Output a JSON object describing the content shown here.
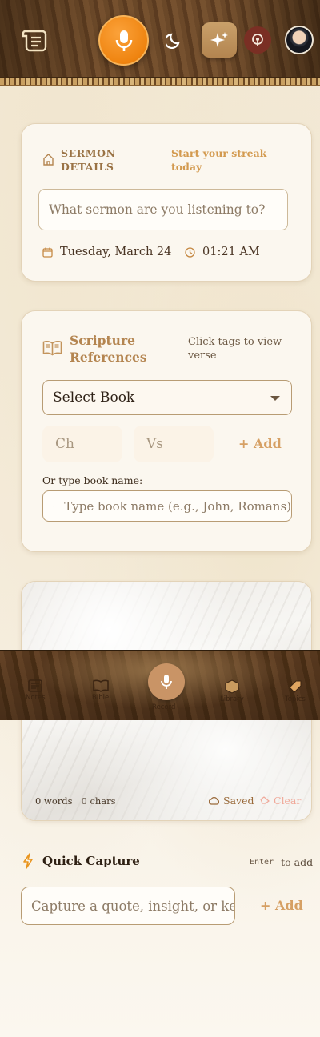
{
  "header": {
    "icons": [
      "scroll-icon",
      "microphone-icon",
      "moon-icon",
      "sparkle-icon",
      "podcast-icon",
      "avatar"
    ]
  },
  "sermon": {
    "section_label": "SERMON DETAILS",
    "section_label_line1": "SERMON",
    "section_label_line2": "DETAILS",
    "streak_line1": "Start your streak",
    "streak_line2": "today",
    "input_placeholder": "What sermon are you listening to?",
    "date": "Tuesday, March 24",
    "time": "01:21 AM"
  },
  "scripture": {
    "title_line1": "Scripture",
    "title_line2": "References",
    "hint_line1": "Click tags to view",
    "hint_line2": "verse",
    "select_book": "Select Book",
    "chapter_placeholder": "Ch",
    "verse_placeholder": "Vs",
    "add_label": "+ Add",
    "or_type_label": "Or type book name:",
    "search_placeholder": "Type book name (e.g., John, Romans)"
  },
  "notes": {
    "words": "0 words",
    "chars": "0 chars",
    "saved_label": "Saved",
    "clear_label": "Clear"
  },
  "bottom_nav": {
    "items": [
      {
        "label": "Notes",
        "icon": "notes-icon"
      },
      {
        "label": "Bible",
        "icon": "bible-icon"
      },
      {
        "label": "Record",
        "icon": "microphone-icon"
      },
      {
        "label": "Library",
        "icon": "box-icon"
      },
      {
        "label": "Topics",
        "icon": "tag-icon"
      }
    ]
  },
  "quick_capture": {
    "title": "Quick Capture",
    "kbd": "Enter",
    "hint": "to add",
    "placeholder": "Capture a quote, insight, or key point",
    "add_label": "+ Add"
  },
  "colors": {
    "accent_orange": "#ef8410",
    "accent_gold": "#b48550",
    "clear_red": "#f0a99a"
  }
}
